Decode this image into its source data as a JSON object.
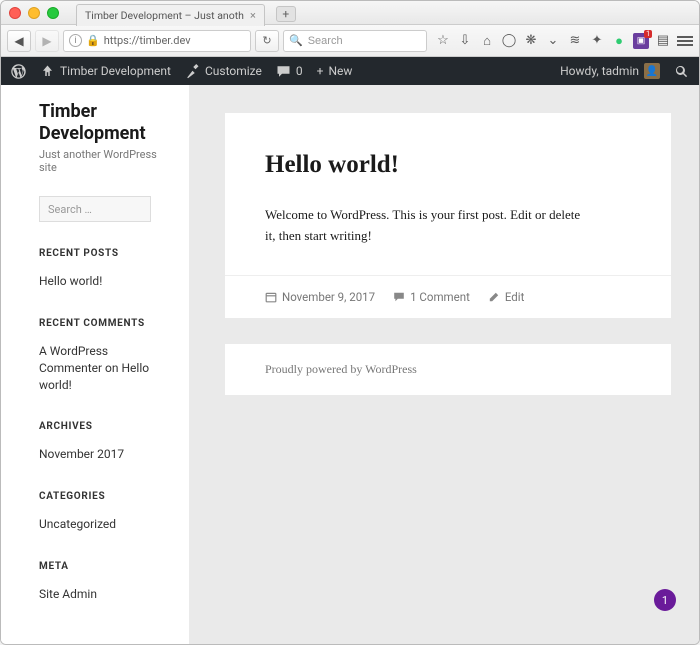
{
  "browser": {
    "tab_title": "Timber Development – Just anoth",
    "url_display": "https://timber.dev",
    "search_placeholder": "Search",
    "badge_count": "1"
  },
  "wpbar": {
    "site_name": "Timber Development",
    "customize": "Customize",
    "comments": "0",
    "new": "New",
    "howdy": "Howdy, tadmin"
  },
  "sidebar": {
    "title": "Timber Development",
    "tagline": "Just another WordPress site",
    "search_placeholder": "Search …",
    "recent_posts": {
      "heading": "RECENT POSTS",
      "items": [
        "Hello world!"
      ]
    },
    "recent_comments": {
      "heading": "RECENT COMMENTS",
      "commenter": "A WordPress Commenter",
      "on": " on ",
      "post": "Hello world!"
    },
    "archives": {
      "heading": "ARCHIVES",
      "items": [
        "November 2017"
      ]
    },
    "categories": {
      "heading": "CATEGORIES",
      "items": [
        "Uncategorized"
      ]
    },
    "meta": {
      "heading": "META",
      "items": [
        "Site Admin"
      ]
    }
  },
  "post": {
    "title": "Hello world!",
    "body": "Welcome to WordPress. This is your first post. Edit or delete it, then start writing!",
    "date": "November 9, 2017",
    "comments": "1 Comment",
    "edit": "Edit"
  },
  "footer": {
    "text": "Proudly powered by WordPress"
  },
  "floating": {
    "count": "1"
  }
}
